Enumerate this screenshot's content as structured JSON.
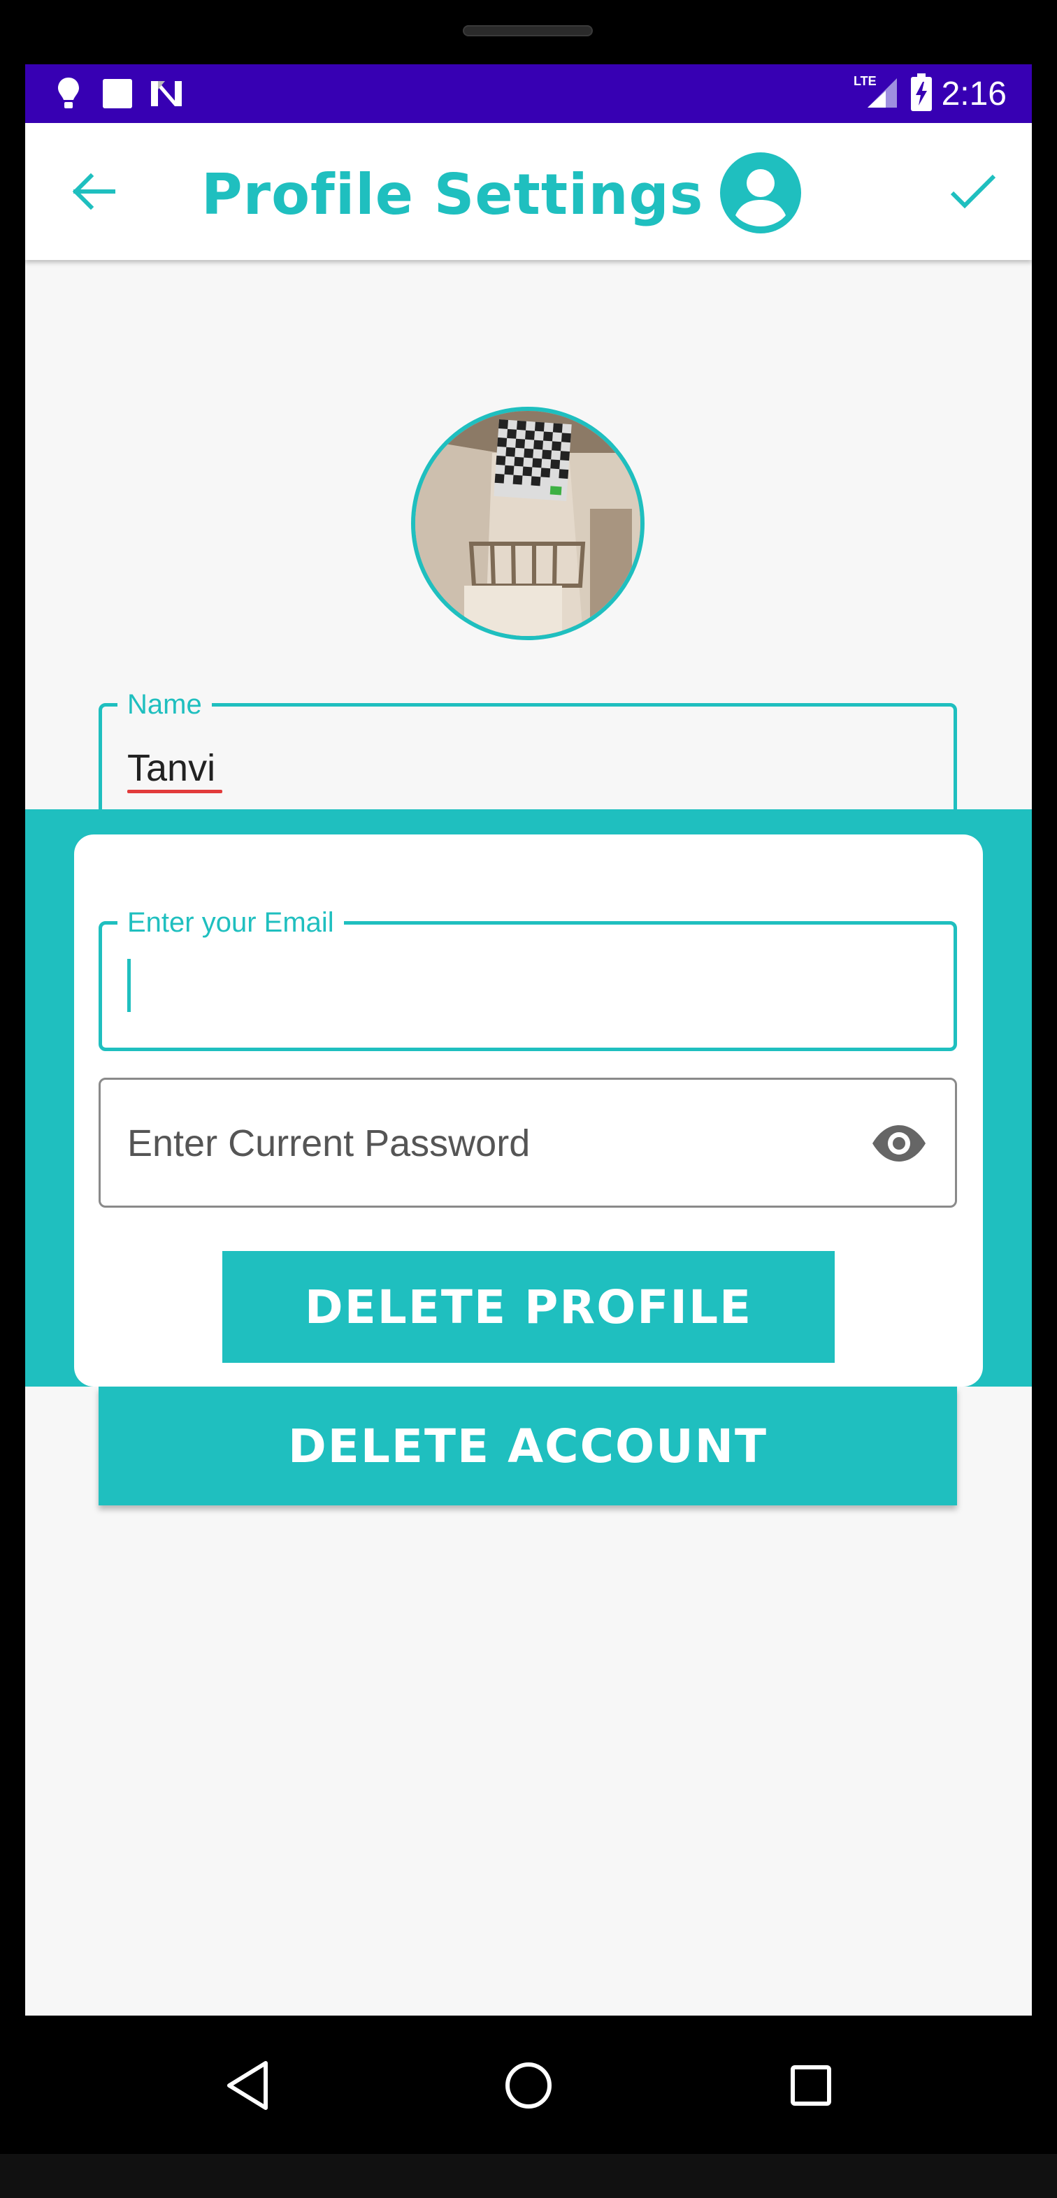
{
  "status_bar": {
    "time": "2:16",
    "network": "LTE",
    "left_icons": [
      "bulb-icon",
      "square-icon",
      "n-icon"
    ],
    "background": "#3700b3"
  },
  "app_bar": {
    "title": "Profile Settings",
    "back_icon": "arrow-left-icon",
    "confirm_icon": "check-icon",
    "accent": "#1fbfbf"
  },
  "profile": {
    "name_label": "Name",
    "name_value": "Tanvi"
  },
  "dialog": {
    "email_label": "Enter your Email",
    "email_value": "",
    "password_placeholder": "Enter Current Password",
    "visibility_icon": "eye-icon",
    "delete_profile_label": "DELETE PROFILE"
  },
  "actions": {
    "delete_account_label": "DELETE ACCOUNT"
  },
  "nav_bar": {
    "icons": [
      "back-triangle-icon",
      "home-circle-icon",
      "recents-square-icon"
    ]
  }
}
